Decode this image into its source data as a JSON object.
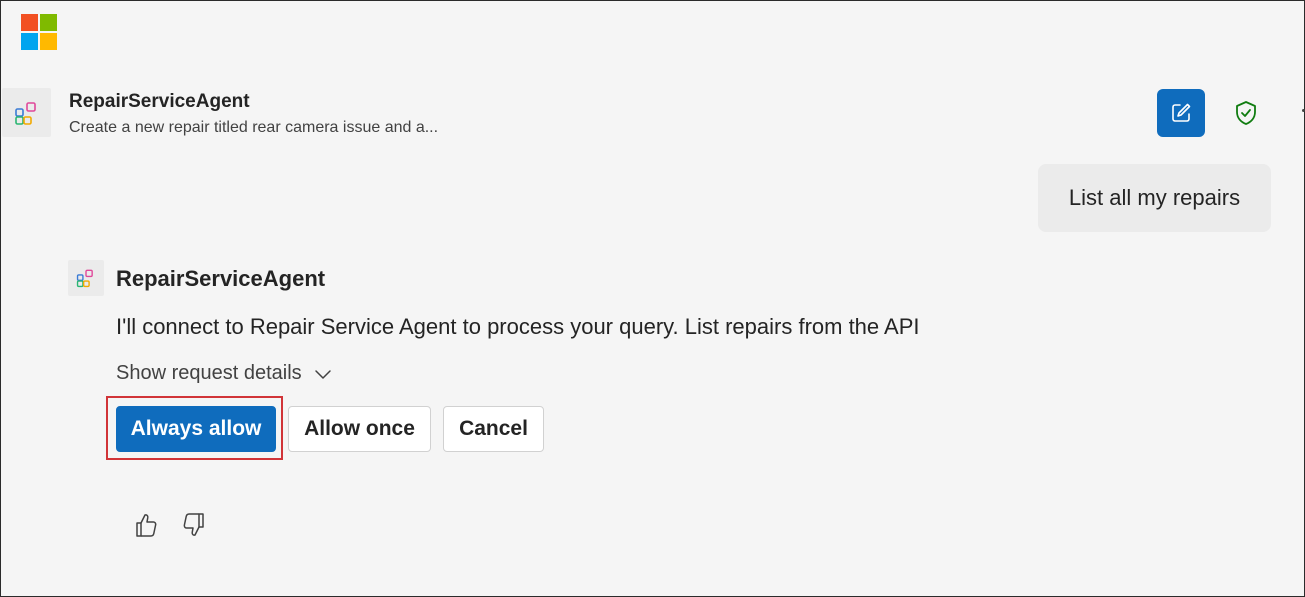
{
  "app": {
    "logo_icon": "microsoft-logo",
    "brand_colors": [
      "#f25022",
      "#7fba00",
      "#00a4ef",
      "#ffb900"
    ]
  },
  "header": {
    "agent_icon": "agent-app-icon",
    "title": "RepairServiceAgent",
    "subtitle": "Create a new repair titled rear camera issue and a...",
    "new_chat_icon": "compose-icon",
    "shield_icon": "shield-check-icon",
    "accent_color": "#0f6cbd"
  },
  "conversation": {
    "user_message": "List all my repairs",
    "bot": {
      "name": "RepairServiceAgent",
      "message": "I'll connect to Repair Service Agent to process your query. List repairs from the API",
      "details_toggle_label": "Show request details",
      "details_toggle_icon": "chevron-down-icon"
    },
    "actions": {
      "always_allow": "Always allow",
      "allow_once": "Allow once",
      "cancel": "Cancel",
      "highlight_color": "#d13438"
    },
    "feedback": {
      "like_icon": "thumbs-up-icon",
      "dislike_icon": "thumbs-down-icon"
    }
  }
}
